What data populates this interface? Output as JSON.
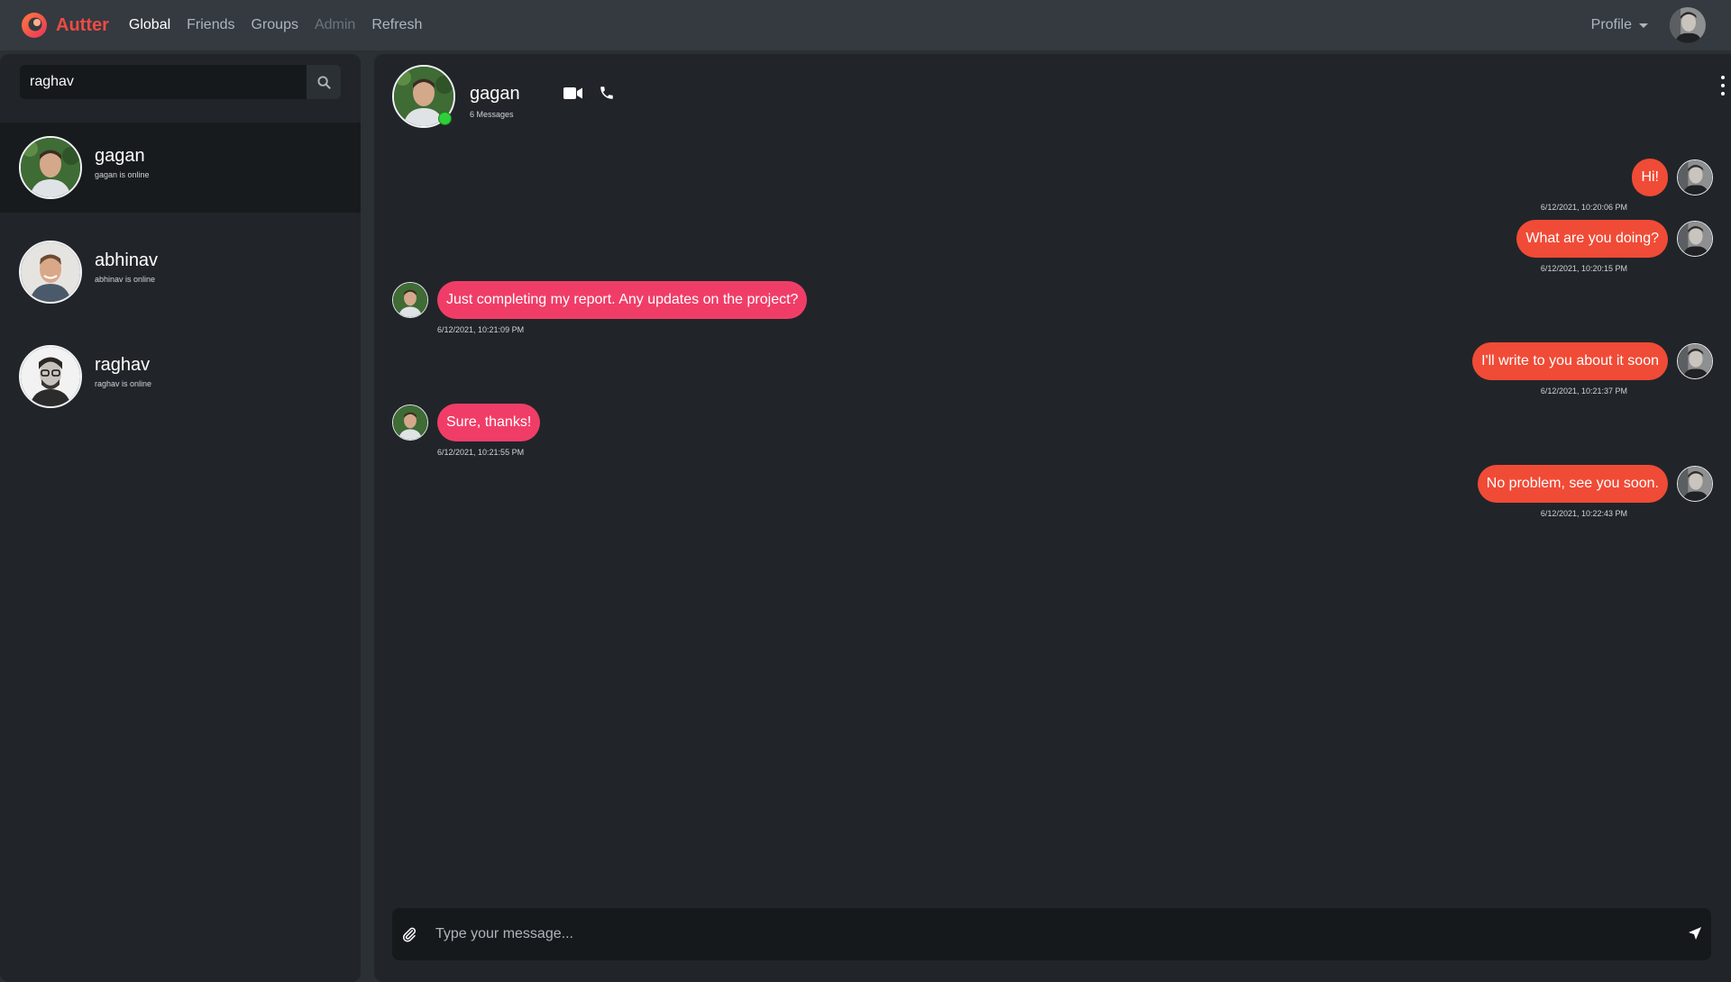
{
  "app": {
    "name": "Autter",
    "brand_color": "#ee4b44"
  },
  "nav": {
    "links": [
      {
        "label": "Global",
        "state": "active"
      },
      {
        "label": "Friends",
        "state": "normal"
      },
      {
        "label": "Groups",
        "state": "normal"
      },
      {
        "label": "Admin",
        "state": "disabled"
      },
      {
        "label": "Refresh",
        "state": "normal"
      }
    ],
    "profile_label": "Profile"
  },
  "search": {
    "value": "raghav",
    "icon": "search-icon"
  },
  "contacts": [
    {
      "name": "gagan",
      "status": "gagan is online",
      "selected": true
    },
    {
      "name": "abhinav",
      "status": "abhinav is online",
      "selected": false
    },
    {
      "name": "raghav",
      "status": "raghav is online",
      "selected": false
    }
  ],
  "chat": {
    "name": "gagan",
    "subtitle": "6 Messages",
    "online": true,
    "messages": [
      {
        "direction": "out",
        "text": "Hi!",
        "time": "6/12/2021, 10:20:06 PM"
      },
      {
        "direction": "out",
        "text": "What are you doing?",
        "time": "6/12/2021, 10:20:15 PM"
      },
      {
        "direction": "in",
        "text": "Just completing my report. Any updates on the project?",
        "time": "6/12/2021, 10:21:09 PM"
      },
      {
        "direction": "out",
        "text": "I'll write to you about it soon",
        "time": "6/12/2021, 10:21:37 PM"
      },
      {
        "direction": "in",
        "text": "Sure, thanks!",
        "time": "6/12/2021, 10:21:55 PM"
      },
      {
        "direction": "out",
        "text": "No problem, see you soon.",
        "time": "6/12/2021, 10:22:43 PM"
      }
    ]
  },
  "composer": {
    "placeholder": "Type your message...",
    "value": ""
  },
  "colors": {
    "outgoing_bubble": "#f04b36",
    "incoming_bubble": "#f03d68",
    "online_dot": "#2fcf3a"
  }
}
